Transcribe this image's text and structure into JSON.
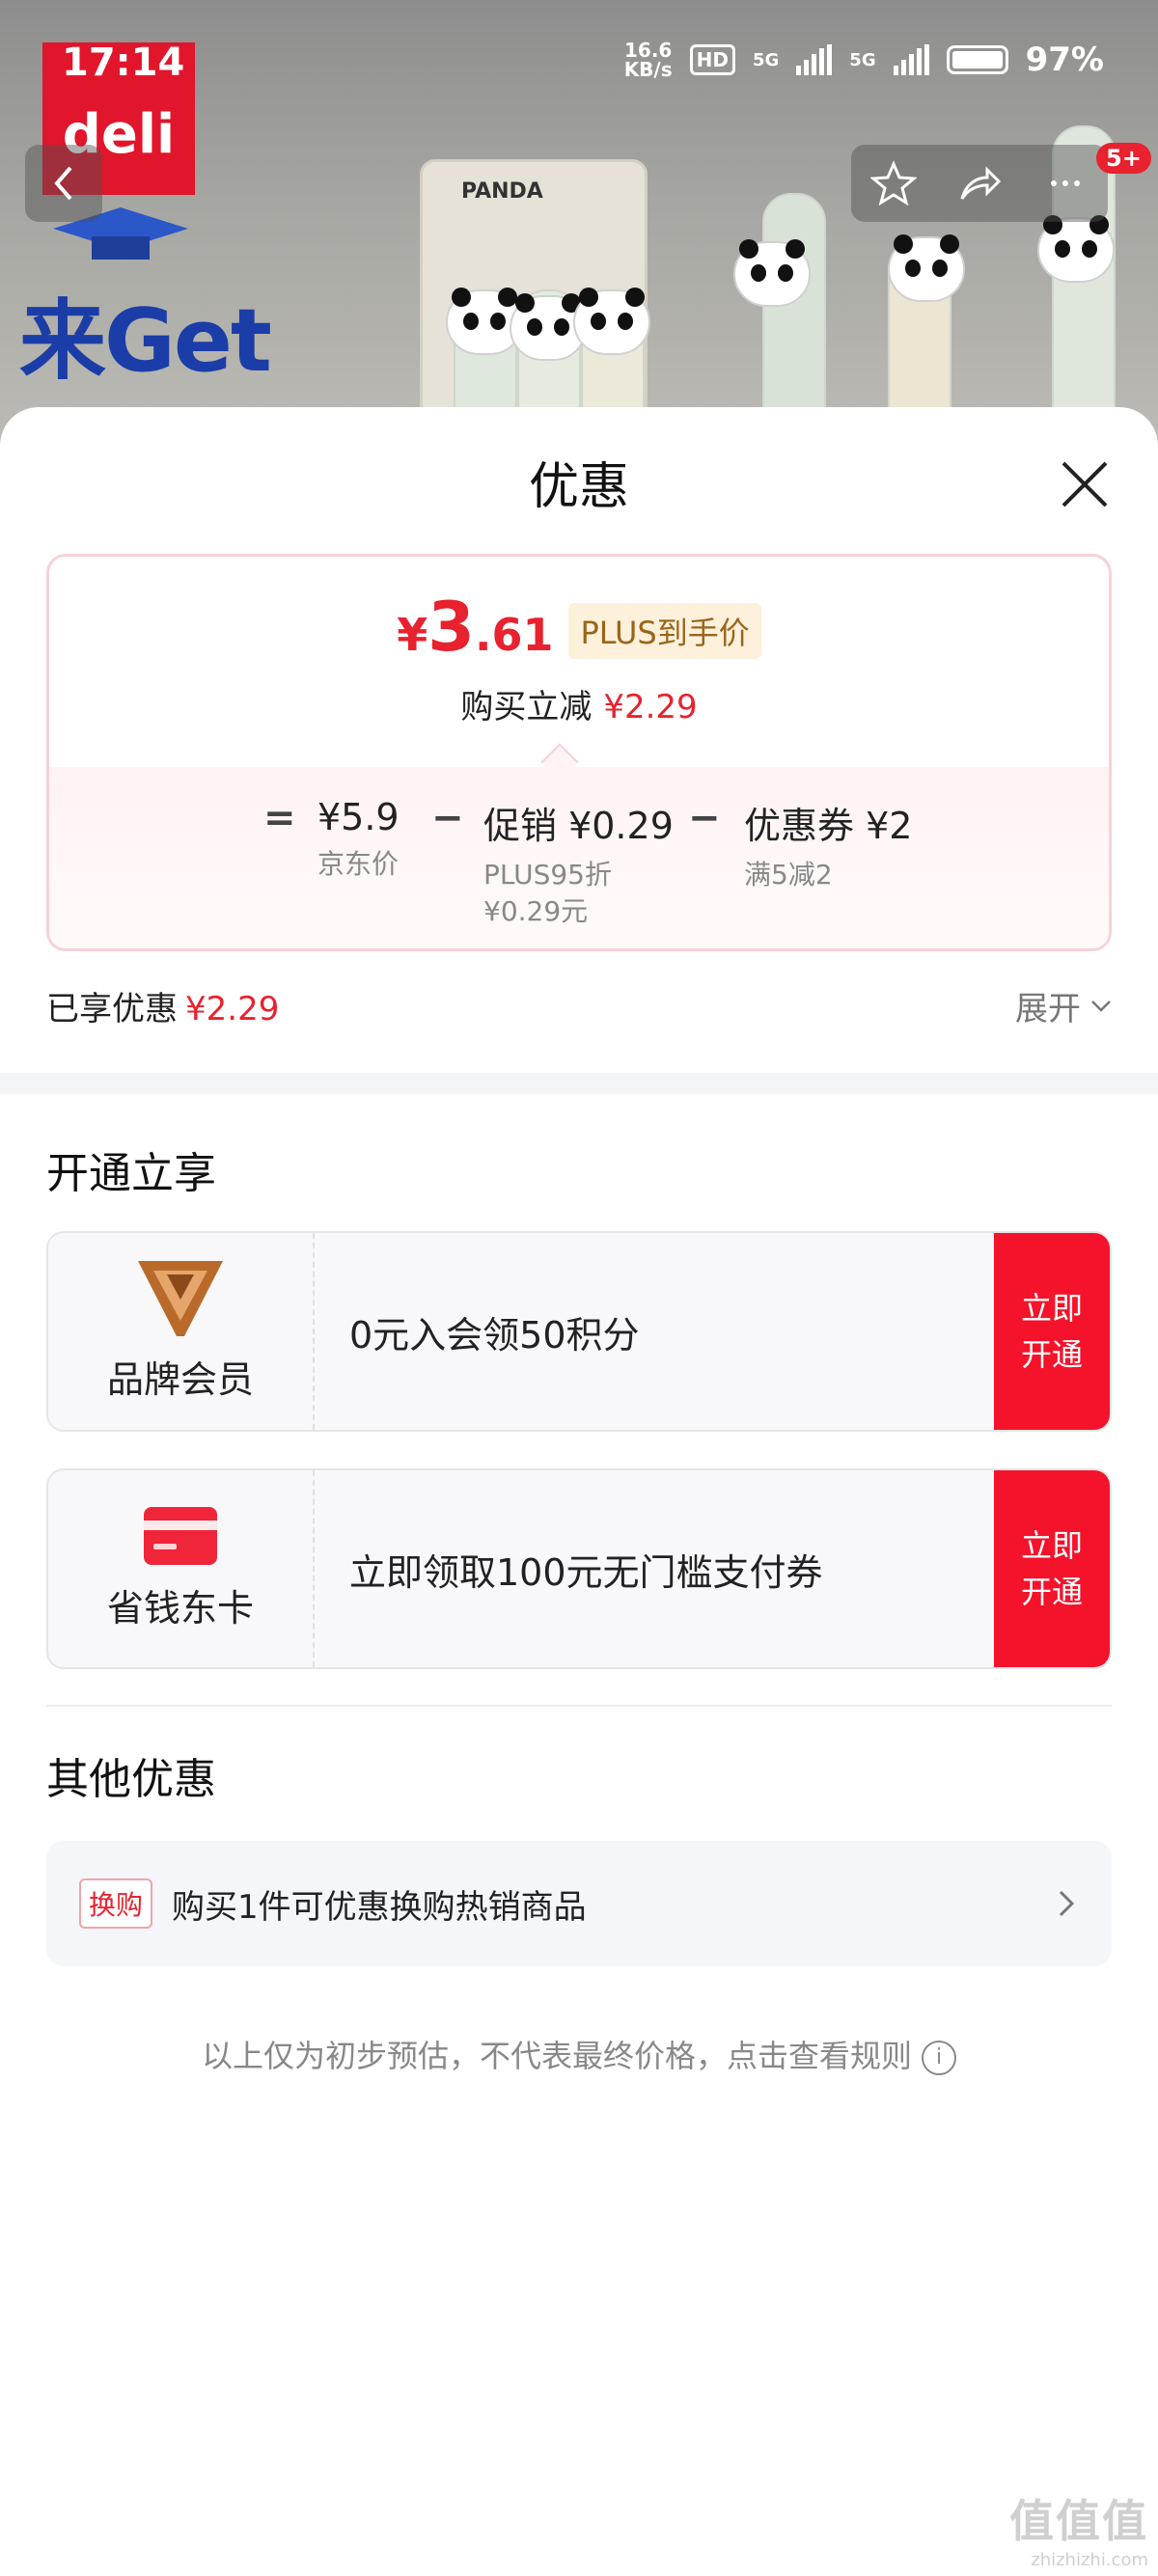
{
  "status_bar": {
    "time": "17:14",
    "net_speed_value": "16.6",
    "net_speed_unit": "KB/s",
    "hd": "HD",
    "network_1": "5G",
    "network_2": "5G",
    "battery": "97%"
  },
  "banner": {
    "brand_logo": "deli",
    "slogan": "来Get",
    "pen_box_brand": "PANDA",
    "message_badge": "5+"
  },
  "sheet": {
    "title": "优惠",
    "final_price": {
      "currency": "¥",
      "integer": "3",
      "decimal": ".61"
    },
    "plus_tag": "PLUS到手价",
    "instant_label": "购买立减",
    "instant_amount": "¥2.29",
    "formula": {
      "equals": "=",
      "minus": "−",
      "items": [
        {
          "main": "¥5.9",
          "sub": "京东价",
          "sub2": ""
        },
        {
          "main": "促销 ¥0.29",
          "sub": "PLUS95折",
          "sub2": "¥0.29元"
        },
        {
          "main": "优惠券 ¥2",
          "sub": "满5减2",
          "sub2": ""
        }
      ]
    },
    "enjoyed_label": "已享优惠",
    "enjoyed_amount": "¥2.29",
    "expand_label": "展开"
  },
  "open_section": {
    "title": "开通立享",
    "cards": [
      {
        "name": "品牌会员",
        "icon": "brand-member-v-icon",
        "desc": "0元入会领50积分",
        "cta_line1": "立即",
        "cta_line2": "开通"
      },
      {
        "name": "省钱东卡",
        "icon": "red-card-icon",
        "desc": "立即领取100元无门槛支付券",
        "cta_line1": "立即",
        "cta_line2": "开通"
      }
    ]
  },
  "other_section": {
    "title": "其他优惠",
    "tag": "换购",
    "text": "购买1件可优惠换购热销商品"
  },
  "footnote": "以上仅为初步预估，不代表最终价格，点击查看规则",
  "watermark": {
    "main": "值值值",
    "sub": "zhizhizhi.com"
  },
  "colors": {
    "accent_red": "#e8222e",
    "cta_red": "#f5122b",
    "plus_gold": "#9a6519"
  }
}
